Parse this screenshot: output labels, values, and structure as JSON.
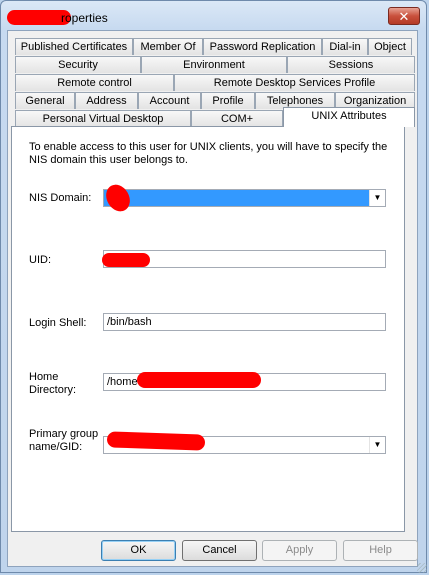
{
  "window": {
    "title_visible": "roperties",
    "close_label": "✕"
  },
  "tabs": {
    "row1": [
      "Published Certificates",
      "Member Of",
      "Password Replication",
      "Dial-in",
      "Object"
    ],
    "row2": [
      "Security",
      "Environment",
      "Sessions"
    ],
    "row3": [
      "Remote control",
      "Remote Desktop Services Profile"
    ],
    "row4": [
      "General",
      "Address",
      "Account",
      "Profile",
      "Telephones",
      "Organization"
    ],
    "row5": [
      "Personal Virtual Desktop",
      "COM+",
      "UNIX Attributes"
    ]
  },
  "unix": {
    "description": "To enable access to this user for UNIX clients, you will have to specify the NIS domain this user belongs to.",
    "nis_label": "NIS Domain:",
    "nis_value": "",
    "uid_label": "UID:",
    "uid_value": "",
    "shell_label": "Login Shell:",
    "shell_value": "/bin/bash",
    "home_label": "Home Directory:",
    "home_value": "/home",
    "group_label": "Primary group name/GID:",
    "group_value": ""
  },
  "buttons": {
    "ok": "OK",
    "cancel": "Cancel",
    "apply": "Apply",
    "help": "Help"
  },
  "colors": {
    "redaction": "#ff0000",
    "selection": "#3399ff",
    "close_button": "#c9503c"
  },
  "icons": {
    "close": "close-icon",
    "dropdown": "chevron-down-icon",
    "resize": "resize-grip-icon"
  }
}
